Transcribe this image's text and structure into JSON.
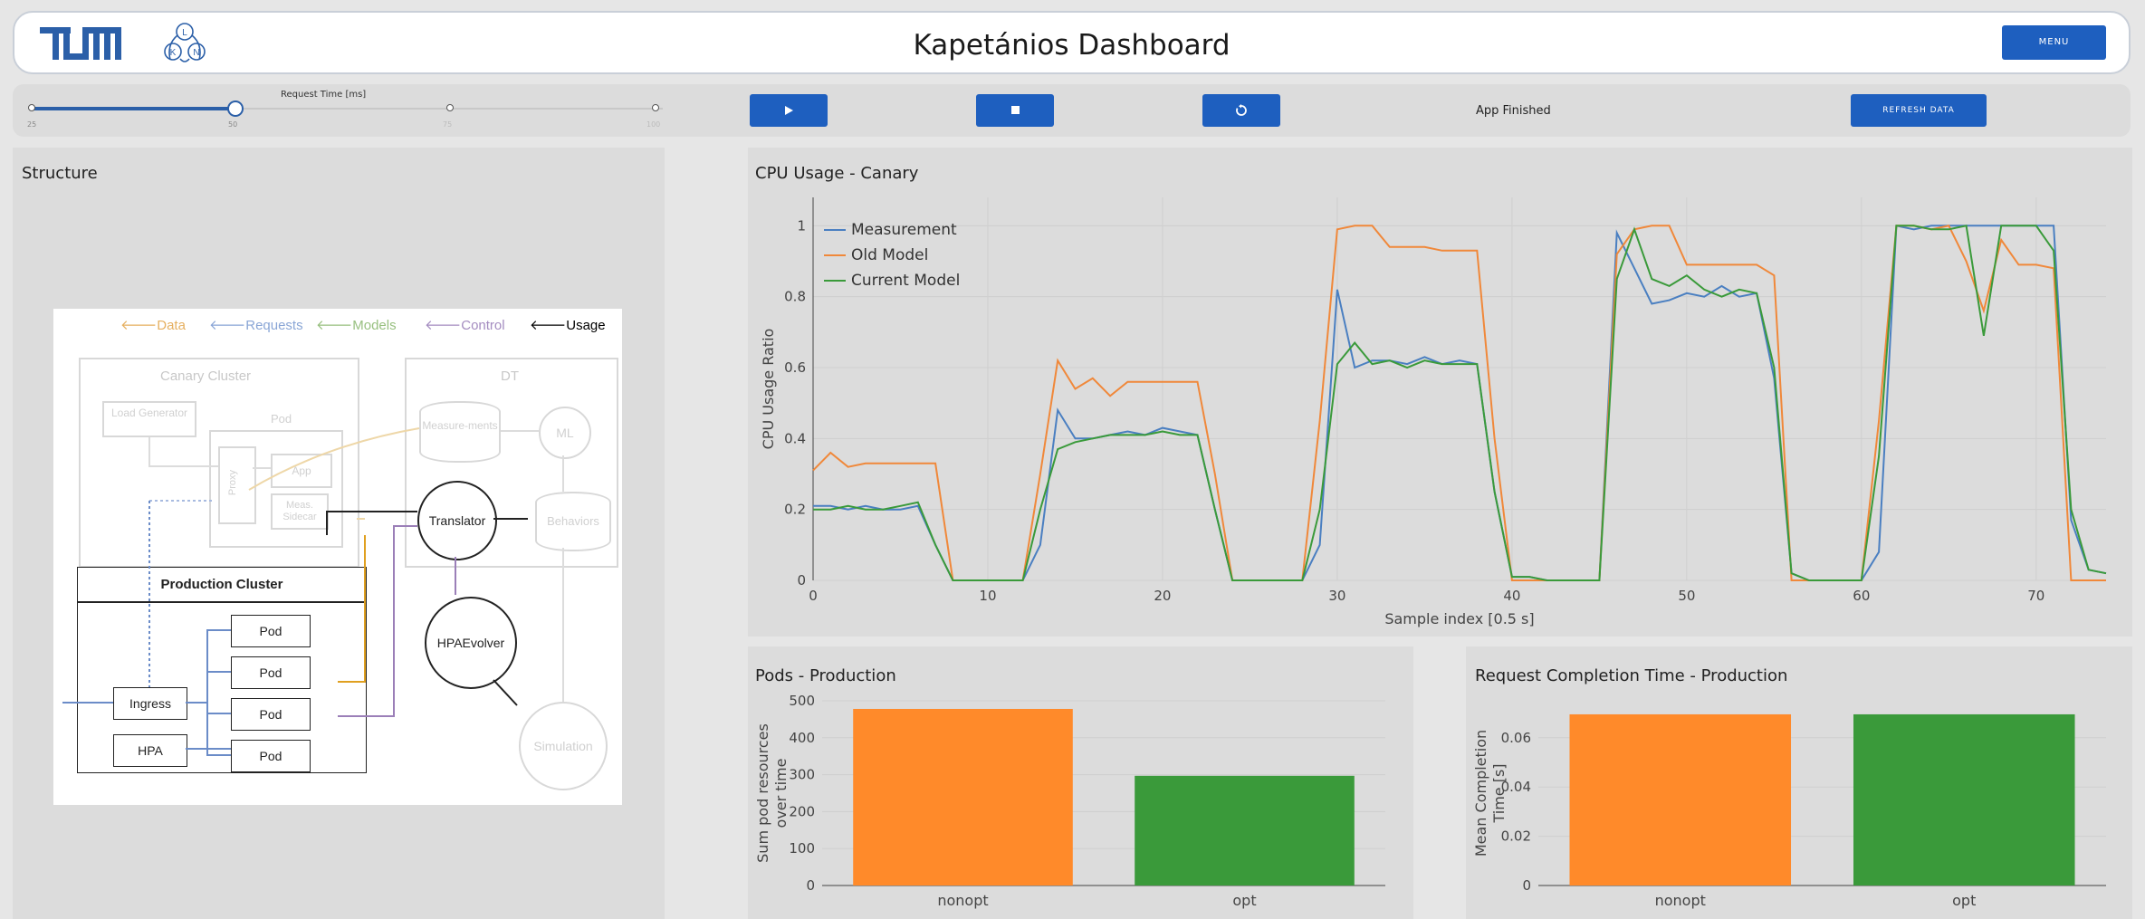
{
  "header": {
    "title": "Kapetánios Dashboard",
    "menu_label": "MENU"
  },
  "controls": {
    "slider_label": "Request Time [ms]",
    "slider_ticks": [
      "25",
      "50",
      "75",
      "100"
    ],
    "slider_value": 50,
    "play_icon": "play-icon",
    "stop_icon": "stop-icon",
    "reload_icon": "reload-icon",
    "status": "App Finished",
    "refresh_label": "REFRESH DATA"
  },
  "structure": {
    "title": "Structure",
    "legend": [
      "Data",
      "Requests",
      "Models",
      "Control",
      "Usage"
    ],
    "canary_cluster": "Canary Cluster",
    "dt": "DT",
    "load_generator": "Load Generator",
    "pod": "Pod",
    "proxy": "Proxy",
    "app": "App",
    "meas_sidecar": "Meas. Sidecar",
    "measurements": "Measure-ments",
    "ml": "ML",
    "behaviors": "Behaviors",
    "translator": "Translator",
    "production_cluster": "Production Cluster",
    "ingress": "Ingress",
    "hpa": "HPA",
    "pods": [
      "Pod",
      "Pod",
      "Pod",
      "Pod"
    ],
    "hpa_evolver": "HPAEvolver",
    "simulation": "Simulation",
    "colors": {
      "data": "#e0a020",
      "requests": "#6b8cc8",
      "models": "#7db060",
      "control": "#9b7fb8",
      "usage": "#000000"
    }
  },
  "chart_data": [
    {
      "type": "line",
      "title": "CPU Usage - Canary",
      "xlabel": "Sample index [0.5 s]",
      "ylabel": "CPU Usage Ratio",
      "xlim": [
        0,
        74
      ],
      "ylim": [
        0,
        1.08
      ],
      "xticks": [
        0,
        10,
        20,
        30,
        40,
        50,
        60,
        70
      ],
      "yticks": [
        0,
        0.2,
        0.4,
        0.6,
        0.8,
        1
      ],
      "ytick_labels": [
        "0",
        "0.2",
        "0.4",
        "0.6",
        "0.8",
        "1"
      ],
      "legend_position": "top-left",
      "grid": true,
      "series": [
        {
          "name": "Measurement",
          "color": "#4a7fc1",
          "x": [
            0,
            1,
            2,
            3,
            4,
            5,
            6,
            7,
            8,
            9,
            10,
            11,
            12,
            13,
            14,
            15,
            16,
            17,
            18,
            19,
            20,
            21,
            22,
            23,
            24,
            25,
            26,
            27,
            28,
            29,
            30,
            31,
            32,
            33,
            34,
            35,
            36,
            37,
            38,
            39,
            40,
            41,
            42,
            43,
            44,
            45,
            46,
            47,
            48,
            49,
            50,
            51,
            52,
            53,
            54,
            55,
            56,
            57,
            58,
            59,
            60,
            61,
            62,
            63,
            64,
            65,
            66,
            67,
            68,
            69,
            70,
            71,
            72,
            73,
            74
          ],
          "y": [
            0.21,
            0.21,
            0.2,
            0.21,
            0.2,
            0.2,
            0.21,
            0.1,
            0.0,
            0.0,
            0.0,
            0.0,
            0.0,
            0.1,
            0.48,
            0.4,
            0.4,
            0.41,
            0.42,
            0.41,
            0.43,
            0.42,
            0.41,
            0.2,
            0.0,
            0.0,
            0.0,
            0.0,
            0.0,
            0.1,
            0.82,
            0.6,
            0.62,
            0.62,
            0.61,
            0.63,
            0.61,
            0.62,
            0.61,
            0.25,
            0.01,
            0.01,
            0.0,
            0.0,
            0.0,
            0.0,
            0.98,
            0.88,
            0.78,
            0.79,
            0.81,
            0.8,
            0.83,
            0.8,
            0.81,
            0.57,
            0.02,
            0.0,
            0.0,
            0.0,
            0.0,
            0.08,
            1.0,
            0.99,
            1.0,
            1.0,
            1.0,
            1.0,
            1.0,
            1.0,
            1.0,
            1.0,
            0.17,
            0.03,
            0.02
          ]
        },
        {
          "name": "Old Model",
          "color": "#f0883a",
          "x": [
            0,
            1,
            2,
            3,
            4,
            5,
            6,
            7,
            8,
            9,
            10,
            11,
            12,
            13,
            14,
            15,
            16,
            17,
            18,
            19,
            20,
            21,
            22,
            23,
            24,
            25,
            26,
            27,
            28,
            29,
            30,
            31,
            32,
            33,
            34,
            35,
            36,
            37,
            38,
            39,
            40,
            41,
            42,
            43,
            44,
            45,
            46,
            47,
            48,
            49,
            50,
            51,
            52,
            53,
            54,
            55,
            56,
            57,
            58,
            59,
            60,
            61,
            62,
            63,
            64,
            65,
            66,
            67,
            68,
            69,
            70,
            71,
            72,
            73,
            74
          ],
          "y": [
            0.31,
            0.36,
            0.32,
            0.33,
            0.33,
            0.33,
            0.33,
            0.33,
            0.0,
            0.0,
            0.0,
            0.0,
            0.0,
            0.3,
            0.62,
            0.54,
            0.57,
            0.52,
            0.56,
            0.56,
            0.56,
            0.56,
            0.56,
            0.3,
            0.0,
            0.0,
            0.0,
            0.0,
            0.0,
            0.45,
            0.99,
            1.0,
            1.0,
            0.94,
            0.94,
            0.94,
            0.93,
            0.93,
            0.93,
            0.4,
            0.0,
            0.0,
            0.0,
            0.0,
            0.0,
            0.0,
            0.92,
            0.99,
            1.0,
            1.0,
            0.89,
            0.89,
            0.89,
            0.89,
            0.89,
            0.86,
            0.0,
            0.0,
            0.0,
            0.0,
            0.0,
            0.45,
            1.0,
            1.0,
            0.99,
            1.0,
            0.9,
            0.76,
            0.96,
            0.89,
            0.89,
            0.88,
            0.0,
            0.0,
            0.0
          ]
        },
        {
          "name": "Current Model",
          "color": "#3a9a3a",
          "x": [
            0,
            1,
            2,
            3,
            4,
            5,
            6,
            7,
            8,
            9,
            10,
            11,
            12,
            13,
            14,
            15,
            16,
            17,
            18,
            19,
            20,
            21,
            22,
            23,
            24,
            25,
            26,
            27,
            28,
            29,
            30,
            31,
            32,
            33,
            34,
            35,
            36,
            37,
            38,
            39,
            40,
            41,
            42,
            43,
            44,
            45,
            46,
            47,
            48,
            49,
            50,
            51,
            52,
            53,
            54,
            55,
            56,
            57,
            58,
            59,
            60,
            61,
            62,
            63,
            64,
            65,
            66,
            67,
            68,
            69,
            70,
            71,
            72,
            73,
            74
          ],
          "y": [
            0.2,
            0.2,
            0.21,
            0.2,
            0.2,
            0.21,
            0.22,
            0.1,
            0.0,
            0.0,
            0.0,
            0.0,
            0.0,
            0.2,
            0.37,
            0.39,
            0.4,
            0.41,
            0.41,
            0.41,
            0.42,
            0.41,
            0.41,
            0.2,
            0.0,
            0.0,
            0.0,
            0.0,
            0.0,
            0.2,
            0.61,
            0.67,
            0.61,
            0.62,
            0.6,
            0.62,
            0.61,
            0.61,
            0.61,
            0.25,
            0.01,
            0.01,
            0.0,
            0.0,
            0.0,
            0.0,
            0.85,
            0.99,
            0.85,
            0.83,
            0.86,
            0.82,
            0.8,
            0.82,
            0.81,
            0.6,
            0.02,
            0.0,
            0.0,
            0.0,
            0.0,
            0.35,
            1.0,
            1.0,
            0.99,
            0.99,
            1.0,
            0.69,
            1.0,
            1.0,
            1.0,
            0.93,
            0.2,
            0.03,
            0.02
          ]
        }
      ]
    },
    {
      "type": "bar",
      "title": "Pods - Production",
      "xlabel": "",
      "ylabel": "Sum pod resources over time",
      "categories": [
        "nonopt",
        "opt"
      ],
      "values": [
        478,
        297
      ],
      "colors": [
        "#ff8a2a",
        "#3a9a3a"
      ],
      "ylim": [
        0,
        500
      ],
      "yticks": [
        0,
        100,
        200,
        300,
        400,
        500
      ],
      "ytick_labels": [
        "0",
        "100",
        "200",
        "300",
        "400",
        "500"
      ]
    },
    {
      "type": "bar",
      "title": "Request Completion Time - Production",
      "xlabel": "",
      "ylabel": "Mean Completion Time [s]",
      "categories": [
        "nonopt",
        "opt"
      ],
      "values": [
        0.0695,
        0.0695
      ],
      "colors": [
        "#ff8a2a",
        "#3a9a3a"
      ],
      "ylim": [
        0,
        0.075
      ],
      "yticks": [
        0,
        0.02,
        0.04,
        0.06
      ],
      "ytick_labels": [
        "0",
        "0.02",
        "0.04",
        "0.06"
      ]
    }
  ]
}
